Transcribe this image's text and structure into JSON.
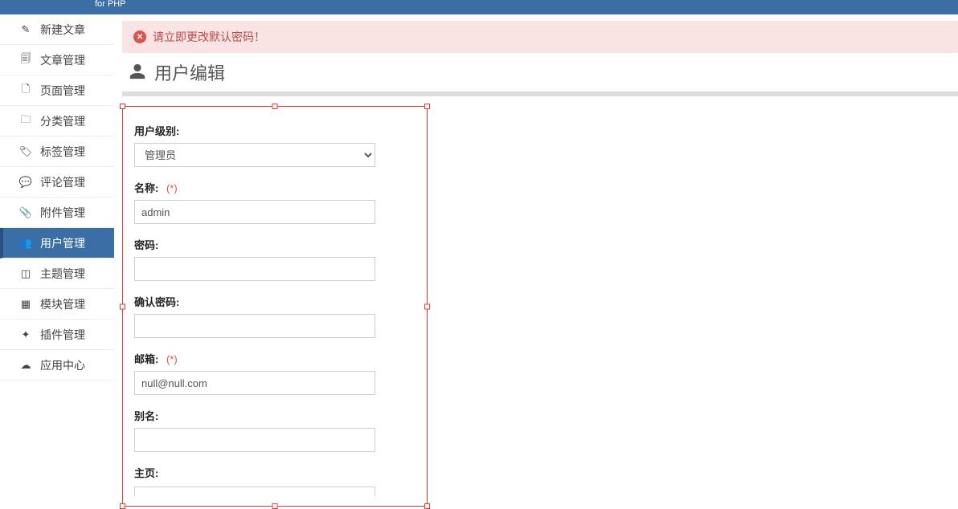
{
  "header": {
    "subtitle": "for PHP"
  },
  "sidebar": {
    "items": [
      {
        "label": "新建文章",
        "icon": "✎",
        "active": false
      },
      {
        "label": "文章管理",
        "icon": "🗐",
        "active": false
      },
      {
        "label": "页面管理",
        "icon": "🗋",
        "active": false
      },
      {
        "label": "分类管理",
        "icon": "🗀",
        "active": false
      },
      {
        "label": "标签管理",
        "icon": "🏷",
        "active": false
      },
      {
        "label": "评论管理",
        "icon": "💬",
        "active": false
      },
      {
        "label": "附件管理",
        "icon": "📎",
        "active": false
      },
      {
        "label": "用户管理",
        "icon": "👥",
        "active": true
      },
      {
        "label": "主题管理",
        "icon": "◫",
        "active": false
      },
      {
        "label": "模块管理",
        "icon": "▦",
        "active": false
      },
      {
        "label": "插件管理",
        "icon": "✦",
        "active": false
      },
      {
        "label": "应用中心",
        "icon": "☁",
        "active": false
      }
    ]
  },
  "alert": {
    "message": "请立即更改默认密码！"
  },
  "page": {
    "title": "用户编辑"
  },
  "form": {
    "level": {
      "label": "用户级别:",
      "value": "管理员",
      "options": [
        "管理员"
      ]
    },
    "name": {
      "label": "名称:",
      "required": "(*)",
      "value": "admin"
    },
    "password": {
      "label": "密码:",
      "value": ""
    },
    "confirm": {
      "label": "确认密码:",
      "value": ""
    },
    "email": {
      "label": "邮箱:",
      "required": "(*)",
      "value": "null@null.com"
    },
    "alias": {
      "label": "别名:",
      "value": ""
    },
    "homepage": {
      "label": "主页:",
      "value": ""
    }
  }
}
